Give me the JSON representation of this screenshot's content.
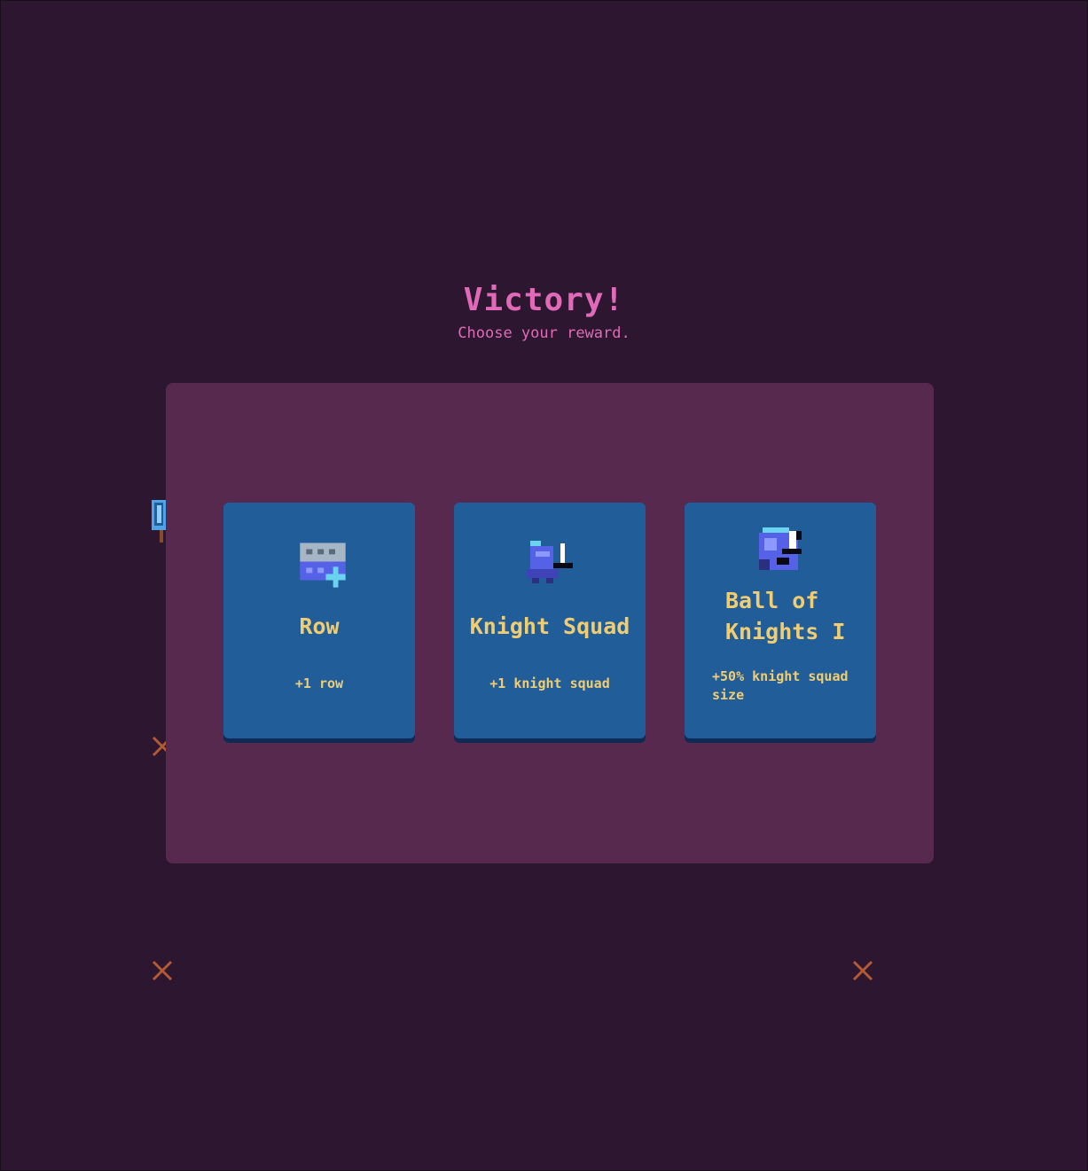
{
  "screen": {
    "title": "Victory!",
    "subtitle": "Choose your reward."
  },
  "rewards": [
    {
      "name": "Row",
      "description": "+1 row",
      "icon": "row-add-icon"
    },
    {
      "name": "Knight Squad",
      "description": "+1 knight squad",
      "icon": "knight-icon"
    },
    {
      "name_line1": "Ball of",
      "name_line2": "Knights I",
      "description_line1": "+50% knight squad",
      "description_line2": "size",
      "icon": "ball-of-knights-icon"
    }
  ],
  "colors": {
    "background": "#2d1730",
    "panel": "#57294e",
    "card": "#215e99",
    "card_text": "#f1cd72",
    "title": "#e06ab8"
  }
}
